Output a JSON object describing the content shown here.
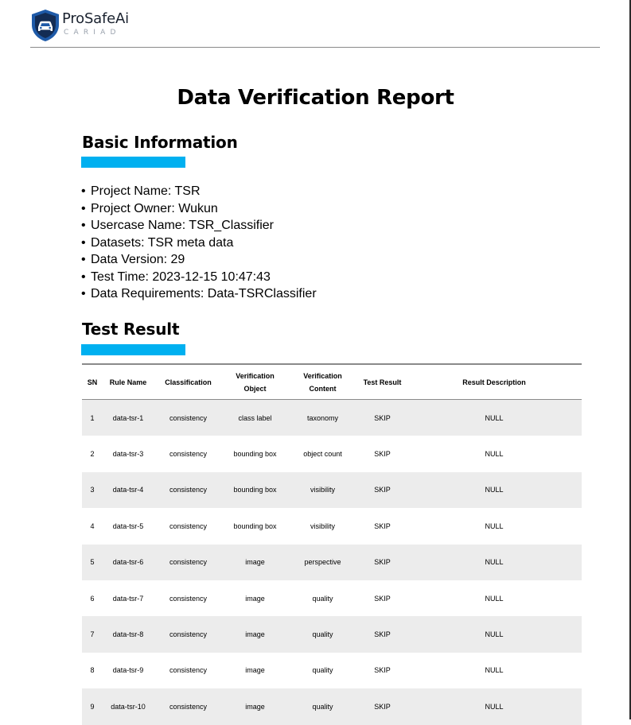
{
  "header": {
    "brand_name": "ProSafeAi",
    "brand_sub": "CARIAD",
    "logo_icon": "shield-car-icon",
    "colors": {
      "logo_blue": "#1e5aa8",
      "logo_dark": "#132c54"
    }
  },
  "title": "Data Verification Report",
  "basic_info": {
    "heading": "Basic Information",
    "accent_color": "#00b0f0",
    "items": [
      "Project Name: TSR",
      "Project Owner: Wukun",
      "Usercase Name: TSR_Classifier",
      "Datasets: TSR meta data",
      "Data Version: 29",
      "Test Time: 2023-12-15 10:47:43",
      "Data Requirements: Data-TSRClassifier"
    ]
  },
  "test_result": {
    "heading": "Test Result",
    "columns": [
      "SN",
      "Rule Name",
      "Classification",
      "Verification Object",
      "Verification Content",
      "Test Result",
      "Result Description"
    ],
    "rows": [
      [
        "1",
        "data-tsr-1",
        "consistency",
        "class label",
        "taxonomy",
        "SKIP",
        "NULL"
      ],
      [
        "2",
        "data-tsr-3",
        "consistency",
        "bounding box",
        "object count",
        "SKIP",
        "NULL"
      ],
      [
        "3",
        "data-tsr-4",
        "consistency",
        "bounding box",
        "visibility",
        "SKIP",
        "NULL"
      ],
      [
        "4",
        "data-tsr-5",
        "consistency",
        "bounding box",
        "visibility",
        "SKIP",
        "NULL"
      ],
      [
        "5",
        "data-tsr-6",
        "consistency",
        "image",
        "perspective",
        "SKIP",
        "NULL"
      ],
      [
        "6",
        "data-tsr-7",
        "consistency",
        "image",
        "quality",
        "SKIP",
        "NULL"
      ],
      [
        "7",
        "data-tsr-8",
        "consistency",
        "image",
        "quality",
        "SKIP",
        "NULL"
      ],
      [
        "8",
        "data-tsr-9",
        "consistency",
        "image",
        "quality",
        "SKIP",
        "NULL"
      ],
      [
        "9",
        "data-tsr-10",
        "consistency",
        "image",
        "quality",
        "SKIP",
        "NULL"
      ]
    ],
    "stripe_color": "#ececec"
  }
}
